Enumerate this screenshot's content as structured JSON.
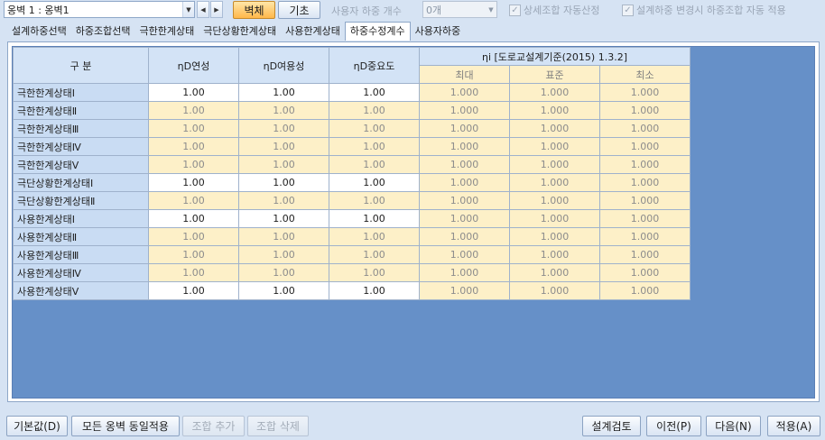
{
  "toolbar": {
    "wall_select_value": "옹벽 1 : 옹벽1",
    "prev_icon": "triangle-left-icon",
    "next_icon": "triangle-right-icon",
    "btn_wall": "벽체",
    "btn_base": "기초",
    "user_load_count_label": "사용자 하중 개수",
    "user_load_count_value": "0개",
    "chk_detail_auto": "상세조합 자동산정",
    "chk_auto_apply": "설계하중 변경시 하중조합 자동 적용"
  },
  "tabs": [
    "설계하중선택",
    "하중조합선택",
    "극한한계상태",
    "극단상황한계상태",
    "사용한계상태",
    "하중수정계수",
    "사용자하중"
  ],
  "active_tab": "하중수정계수",
  "table": {
    "header": {
      "category": "구 분",
      "ductility": "ηD연성",
      "redundancy": "ηD여용성",
      "importance": "ηD중요도",
      "eta_group": "ηi [도로교설계기준(2015) 1.3.2]",
      "max": "최대",
      "std": "표준",
      "min": "최소"
    },
    "rows": [
      {
        "name": "극한한계상태Ⅰ",
        "duct": "1.00",
        "red": "1.00",
        "imp": "1.00",
        "max": "1.000",
        "std": "1.000",
        "min": "1.000",
        "editable": true
      },
      {
        "name": "극한한계상태Ⅱ",
        "duct": "1.00",
        "red": "1.00",
        "imp": "1.00",
        "max": "1.000",
        "std": "1.000",
        "min": "1.000",
        "editable": false
      },
      {
        "name": "극한한계상태Ⅲ",
        "duct": "1.00",
        "red": "1.00",
        "imp": "1.00",
        "max": "1.000",
        "std": "1.000",
        "min": "1.000",
        "editable": false
      },
      {
        "name": "극한한계상태Ⅳ",
        "duct": "1.00",
        "red": "1.00",
        "imp": "1.00",
        "max": "1.000",
        "std": "1.000",
        "min": "1.000",
        "editable": false
      },
      {
        "name": "극한한계상태Ⅴ",
        "duct": "1.00",
        "red": "1.00",
        "imp": "1.00",
        "max": "1.000",
        "std": "1.000",
        "min": "1.000",
        "editable": false
      },
      {
        "name": "극단상황한계상태Ⅰ",
        "duct": "1.00",
        "red": "1.00",
        "imp": "1.00",
        "max": "1.000",
        "std": "1.000",
        "min": "1.000",
        "editable": true
      },
      {
        "name": "극단상황한계상태Ⅱ",
        "duct": "1.00",
        "red": "1.00",
        "imp": "1.00",
        "max": "1.000",
        "std": "1.000",
        "min": "1.000",
        "editable": false
      },
      {
        "name": "사용한계상태Ⅰ",
        "duct": "1.00",
        "red": "1.00",
        "imp": "1.00",
        "max": "1.000",
        "std": "1.000",
        "min": "1.000",
        "editable": true
      },
      {
        "name": "사용한계상태Ⅱ",
        "duct": "1.00",
        "red": "1.00",
        "imp": "1.00",
        "max": "1.000",
        "std": "1.000",
        "min": "1.000",
        "editable": false
      },
      {
        "name": "사용한계상태Ⅲ",
        "duct": "1.00",
        "red": "1.00",
        "imp": "1.00",
        "max": "1.000",
        "std": "1.000",
        "min": "1.000",
        "editable": false
      },
      {
        "name": "사용한계상태Ⅳ",
        "duct": "1.00",
        "red": "1.00",
        "imp": "1.00",
        "max": "1.000",
        "std": "1.000",
        "min": "1.000",
        "editable": false
      },
      {
        "name": "사용한계상태Ⅴ",
        "duct": "1.00",
        "red": "1.00",
        "imp": "1.00",
        "max": "1.000",
        "std": "1.000",
        "min": "1.000",
        "editable": true
      }
    ]
  },
  "bottom": {
    "btn_default": "기본값(D)",
    "btn_apply_all": "모든 옹벽 동일적용",
    "btn_add_combo": "조합 추가",
    "btn_del_combo": "조합 삭제",
    "btn_check": "설계검토",
    "btn_prev": "이전(P)",
    "btn_next": "다음(N)",
    "btn_apply": "적용(A)"
  },
  "colors": {
    "accent_active_button": "#ffb74a",
    "grid_background": "#6690c8",
    "readonly_cell": "#fdf0c8",
    "header_cell": "#d3e3f6"
  }
}
